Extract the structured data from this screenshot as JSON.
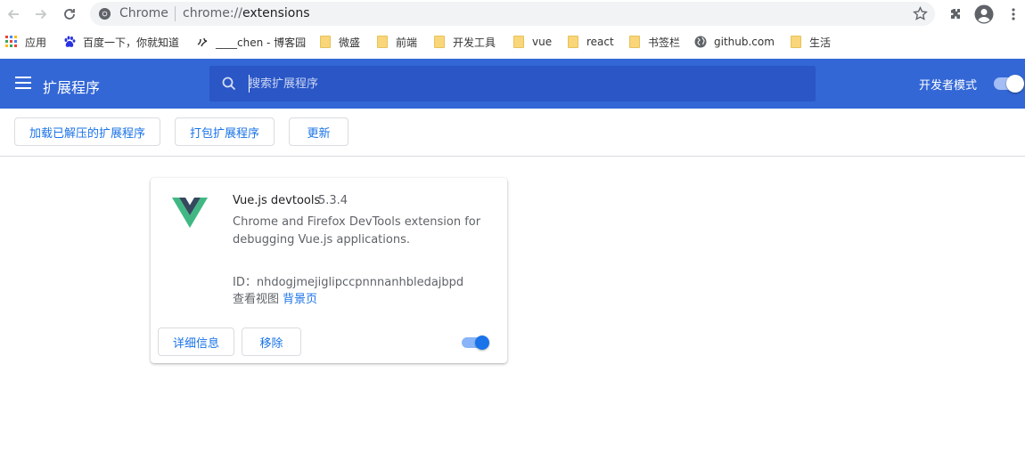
{
  "browser": {
    "back_icon": "arrow-left-icon",
    "forward_icon": "arrow-right-icon",
    "reload_icon": "reload-icon",
    "omnibox": {
      "site_label": "Chrome",
      "url_scheme": "chrome://",
      "url_host": "extensions"
    },
    "star_icon": "star-outline-icon",
    "extensions_icon": "puzzle-icon",
    "profile_icon": "account-circle-icon",
    "menu_icon": "more-vert-icon"
  },
  "bookmarks": {
    "items": [
      {
        "label": "应用",
        "icon": "apps-grid-icon"
      },
      {
        "label": "百度一下，你就知道",
        "icon": "baidu-paw-icon"
      },
      {
        "label": "____chen - 博客园",
        "icon": "cnblogs-icon"
      },
      {
        "label": "微盛",
        "icon": "folder-icon"
      },
      {
        "label": "前端",
        "icon": "folder-icon"
      },
      {
        "label": "开发工具",
        "icon": "folder-icon"
      },
      {
        "label": "vue",
        "icon": "folder-icon"
      },
      {
        "label": "react",
        "icon": "folder-icon"
      },
      {
        "label": "书签栏",
        "icon": "folder-icon"
      },
      {
        "label": "github.com",
        "icon": "globe-icon"
      },
      {
        "label": "生活",
        "icon": "folder-icon"
      }
    ]
  },
  "extensions_page": {
    "title": "扩展程序",
    "search": {
      "placeholder": "搜索扩展程序",
      "value": ""
    },
    "developer_mode": {
      "label": "开发者模式",
      "enabled": true
    },
    "dev_actions": {
      "load_unpacked": "加载已解压的扩展程序",
      "pack": "打包扩展程序",
      "update": "更新"
    },
    "colors": {
      "header": "#3367d6",
      "search_bg": "#2a56c6",
      "accent": "#1a73e8"
    }
  },
  "extension_card": {
    "name": "Vue.js devtools",
    "version": "5.3.4",
    "description": "Chrome and Firefox DevTools extension for debugging Vue.js applications.",
    "id_text": "ID：nhdogjmejiglipccpnnnanhbledajbpd",
    "views_label": "查看视图",
    "views_link": "背景页",
    "details_button": "详细信息",
    "remove_button": "移除",
    "enabled": true,
    "icon": "vue-logo-icon"
  }
}
